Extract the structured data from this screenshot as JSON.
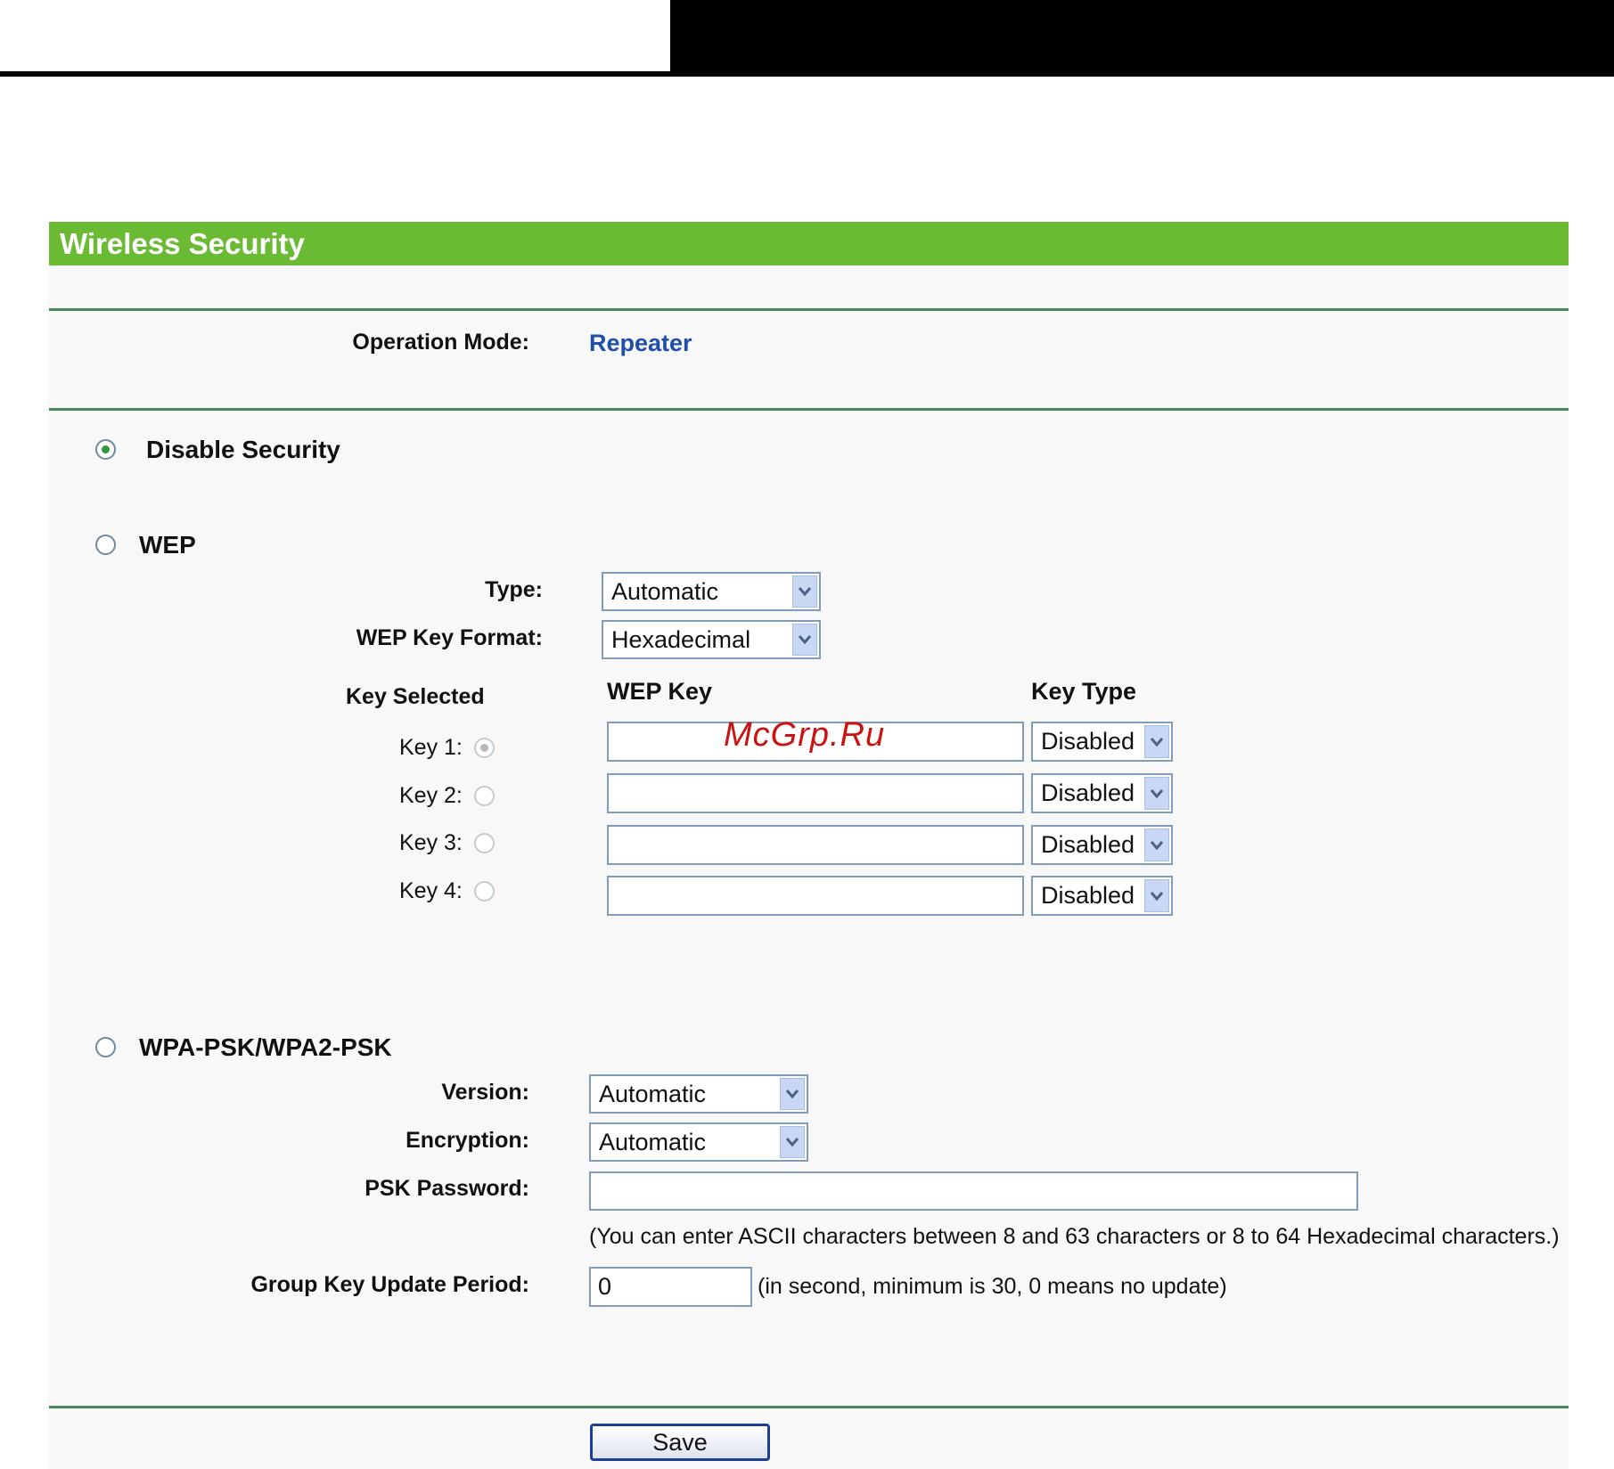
{
  "header": {
    "title": "Wireless Security"
  },
  "operation_mode": {
    "label": "Operation Mode:",
    "value": "Repeater"
  },
  "disable_security": {
    "label": "Disable Security",
    "selected": true
  },
  "wep": {
    "label": "WEP",
    "selected": false,
    "type_label": "Type:",
    "type_value": "Automatic",
    "key_format_label": "WEP Key Format:",
    "key_format_value": "Hexadecimal",
    "col_key_selected": "Key Selected",
    "col_wep_key": "WEP Key",
    "col_key_type": "Key Type",
    "keys": [
      {
        "label": "Key 1:",
        "value": "",
        "type": "Disabled",
        "selected": true
      },
      {
        "label": "Key 2:",
        "value": "",
        "type": "Disabled",
        "selected": false
      },
      {
        "label": "Key 3:",
        "value": "",
        "type": "Disabled",
        "selected": false
      },
      {
        "label": "Key 4:",
        "value": "",
        "type": "Disabled",
        "selected": false
      }
    ]
  },
  "wpa": {
    "label": "WPA-PSK/WPA2-PSK",
    "selected": false,
    "version_label": "Version:",
    "version_value": "Automatic",
    "encryption_label": "Encryption:",
    "encryption_value": "Automatic",
    "psk_label": "PSK Password:",
    "psk_value": "",
    "psk_hint": "(You can enter ASCII characters between 8 and 63 characters or 8 to 64 Hexadecimal characters.)",
    "group_key_label": "Group Key Update Period:",
    "group_key_value": "0",
    "group_key_hint": "(in second, minimum is 30, 0 means no update)"
  },
  "save_label": "Save",
  "watermark": "McGrp.Ru",
  "colors": {
    "title_bar": "#6aba34",
    "divider": "#4a8a5a",
    "mode_value": "#1f4fa8",
    "watermark": "#cc1111"
  }
}
